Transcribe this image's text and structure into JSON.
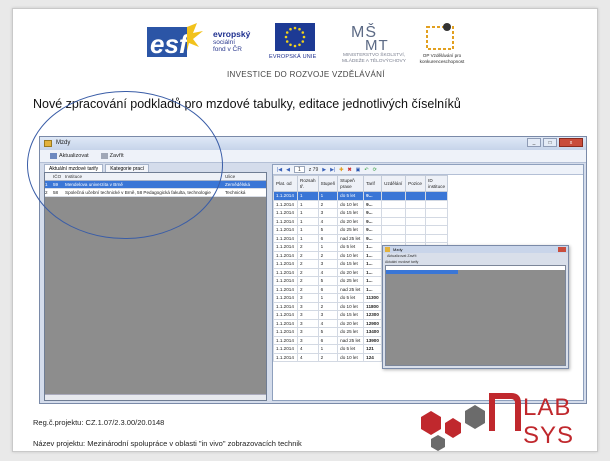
{
  "banner": {
    "esf_line1": "evropský",
    "esf_line2": "sociální",
    "esf_line3": "fond v ČR",
    "eu_caption": "EVROPSKÁ UNIE",
    "msmt_caption": "MINISTERSTVO ŠKOLSTVÍ, MLÁDEŽE A TĚLOVÝCHOVY",
    "op_caption": "OP Vzdělávání pro konkurenceschopnost",
    "tagline": "INVESTICE DO ROZVOJE VZDĚLÁVÁNÍ"
  },
  "heading": "Nové zpracování podkladů pro mzdové tabulky, editace jednotlivých číselníků",
  "app": {
    "title": "Mzdy",
    "window_buttons": [
      "_",
      "□",
      "x"
    ],
    "toolbar": {
      "refresh": "Aktualizovat",
      "close": "Zavřít"
    },
    "tabs": [
      "Aktuální mzdové tarify",
      "Kategorie prací"
    ],
    "left_columns": [
      "",
      "IČO",
      "Instituce",
      "Ulice"
    ],
    "left_rows": [
      {
        "num": "1",
        "ico": "59",
        "name": "Mendelova univerzita v Brně",
        "street": "Zemědělská",
        "selected": true
      },
      {
        "num": "2",
        "ico": "58",
        "name": "Společná učební technické v Brně, 58 Pedagogická fakulta, technologie",
        "street": "Technická",
        "selected": false
      }
    ],
    "navigator": {
      "page": "1",
      "of_text": "z 79"
    },
    "grid_columns": [
      "Plat. od",
      "Rozsah tř.",
      "Stupeň",
      "Stupeň praxe",
      "Tarif",
      "Uzdělání",
      "Pozice",
      "ID instituce"
    ],
    "grid_rows": [
      [
        "1.1.2014",
        "1",
        "1",
        "do 5 let",
        "9...",
        "",
        "",
        ""
      ],
      [
        "1.1.2014",
        "1",
        "2",
        "do 10 let",
        "9...",
        "",
        "",
        ""
      ],
      [
        "1.1.2014",
        "1",
        "3",
        "do 15 let",
        "9...",
        "",
        "",
        ""
      ],
      [
        "1.1.2014",
        "1",
        "4",
        "do 20 let",
        "9...",
        "",
        "",
        ""
      ],
      [
        "1.1.2014",
        "1",
        "5",
        "do 25 let",
        "9...",
        "",
        "",
        ""
      ],
      [
        "1.1.2014",
        "1",
        "6",
        "nad 25 let",
        "9...",
        "",
        "",
        ""
      ],
      [
        "1.1.2014",
        "2",
        "1",
        "do 5 let",
        "1...",
        "",
        "",
        ""
      ],
      [
        "1.1.2014",
        "2",
        "2",
        "do 10 let",
        "1...",
        "",
        "",
        ""
      ],
      [
        "1.1.2014",
        "2",
        "3",
        "do 15 let",
        "1...",
        "",
        "",
        ""
      ],
      [
        "1.1.2014",
        "2",
        "4",
        "do 20 let",
        "1...",
        "",
        "",
        ""
      ],
      [
        "1.1.2014",
        "2",
        "5",
        "do 25 let",
        "1...",
        "",
        "",
        ""
      ],
      [
        "1.1.2014",
        "2",
        "6",
        "nad 25 let",
        "1...",
        "",
        "",
        ""
      ],
      [
        "1.1.2014",
        "3",
        "1",
        "do 5 let",
        "11300",
        "",
        "",
        "95"
      ],
      [
        "1.1.2014",
        "3",
        "2",
        "do 10 let",
        "11800",
        "",
        "",
        "95"
      ],
      [
        "1.1.2014",
        "3",
        "3",
        "do 15 let",
        "12300",
        "",
        "",
        "95"
      ],
      [
        "1.1.2014",
        "3",
        "4",
        "do 20 let",
        "12900",
        "",
        "",
        "95"
      ],
      [
        "1.1.2014",
        "3",
        "5",
        "do 25 let",
        "13400",
        "",
        "",
        "95"
      ],
      [
        "1.1.2014",
        "3",
        "6",
        "nad 25 let",
        "13900",
        "",
        "",
        "95"
      ],
      [
        "1.1.2014",
        "4",
        "1",
        "do 5 let",
        "121",
        "",
        "",
        ""
      ],
      [
        "1.1.2014",
        "4",
        "2",
        "do 10 let",
        "124",
        "",
        "",
        ""
      ]
    ],
    "overlay": {
      "title": "Mzdy",
      "tool": "Aktualizovat   Zavřít",
      "tab": "Aktuální mzdové tarify"
    }
  },
  "footer": {
    "reg": "Reg.č.projektu: CZ.1.07/2.3.00/20.0148",
    "nazev": "Název projektu: Mezinárodní spolupráce v oblasti \"in vivo\" zobrazovacích technik",
    "logo_text": "NLAB SYS"
  },
  "colors": {
    "selection": "#3a76d6",
    "ellipse": "#3a5da7",
    "nlab_red": "#c0282d"
  }
}
